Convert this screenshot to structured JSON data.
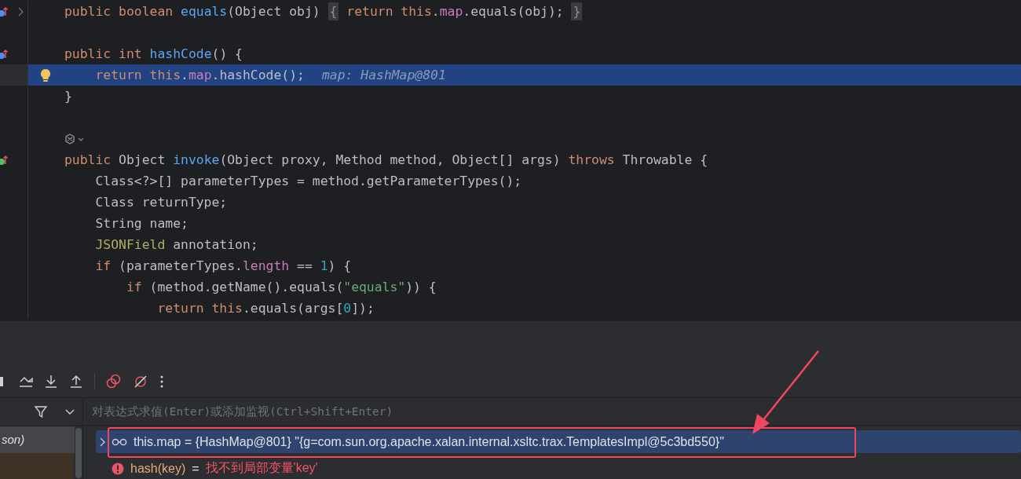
{
  "editor": {
    "lines": [
      {
        "marker": {
          "color": "#548af7"
        },
        "fold": true,
        "bulb": false,
        "highlighted": false,
        "tokens": [
          {
            "text": "public boolean ",
            "kind": "keyword"
          },
          {
            "text": "equals",
            "kind": "function"
          },
          {
            "text": "(Object obj) ",
            "kind": "plain"
          },
          {
            "text": "{",
            "kind": "fold"
          },
          {
            "text": " return this",
            "kind": "keyword"
          },
          {
            "text": ".",
            "kind": "plain"
          },
          {
            "text": "map",
            "kind": "field"
          },
          {
            "text": ".equals(obj); ",
            "kind": "plain"
          },
          {
            "text": "}",
            "kind": "fold"
          }
        ]
      },
      {
        "fold": false,
        "bulb": false,
        "highlighted": false
      },
      {
        "marker": {
          "color": "#548af7"
        },
        "fold": false,
        "bulb": false,
        "highlighted": false,
        "tokens": [
          {
            "text": "public int ",
            "kind": "keyword"
          },
          {
            "text": "hashCode",
            "kind": "function"
          },
          {
            "text": "() {",
            "kind": "plain"
          }
        ]
      },
      {
        "fold": false,
        "bulb": true,
        "highlighted": true,
        "tokens": [
          {
            "text": "    return this",
            "kind": "keyword"
          },
          {
            "text": ".",
            "kind": "plain"
          },
          {
            "text": "map",
            "kind": "field"
          },
          {
            "text": ".hashCode();",
            "kind": "plain"
          }
        ],
        "inline_value": "map: HashMap@801"
      },
      {
        "fold": false,
        "bulb": false,
        "highlighted": false,
        "tokens": [
          {
            "text": "}",
            "kind": "plain"
          }
        ]
      },
      {
        "fold": false,
        "bulb": false,
        "highlighted": false
      },
      {
        "fold": false,
        "bulb": false,
        "highlighted": false,
        "inlay": true
      },
      {
        "marker": {
          "color": "#5fb865"
        },
        "fold": false,
        "bulb": false,
        "highlighted": false,
        "tokens": [
          {
            "text": "public ",
            "kind": "keyword"
          },
          {
            "text": "Object ",
            "kind": "plain"
          },
          {
            "text": "invoke",
            "kind": "function"
          },
          {
            "text": "(Object proxy, Method method, Object[] args) ",
            "kind": "plain"
          },
          {
            "text": "throws",
            "kind": "keyword"
          },
          {
            "text": " Throwable {",
            "kind": "plain"
          }
        ]
      },
      {
        "fold": false,
        "bulb": false,
        "highlighted": false,
        "tokens": [
          {
            "text": "    Class<?>[] parameterTypes = method.getParameterTypes();",
            "kind": "plain"
          }
        ]
      },
      {
        "fold": false,
        "bulb": false,
        "highlighted": false,
        "tokens": [
          {
            "text": "    Class returnType;",
            "kind": "plain"
          }
        ]
      },
      {
        "fold": false,
        "bulb": false,
        "highlighted": false,
        "tokens": [
          {
            "text": "    String name;",
            "kind": "plain"
          }
        ]
      },
      {
        "fold": false,
        "bulb": false,
        "highlighted": false,
        "tokens": [
          {
            "text": "    JSONField",
            "kind": "type"
          },
          {
            "text": " annotation;",
            "kind": "plain"
          }
        ]
      },
      {
        "fold": false,
        "bulb": false,
        "highlighted": false,
        "tokens": [
          {
            "text": "    if",
            "kind": "keyword"
          },
          {
            "text": " (parameterTypes.",
            "kind": "plain"
          },
          {
            "text": "length",
            "kind": "field"
          },
          {
            "text": " == ",
            "kind": "plain"
          },
          {
            "text": "1",
            "kind": "number"
          },
          {
            "text": ") {",
            "kind": "plain"
          }
        ]
      },
      {
        "fold": false,
        "bulb": false,
        "highlighted": false,
        "tokens": [
          {
            "text": "        if",
            "kind": "keyword"
          },
          {
            "text": " (method.getName().equals(",
            "kind": "plain"
          },
          {
            "text": "\"equals\"",
            "kind": "string"
          },
          {
            "text": ")) {",
            "kind": "plain"
          }
        ]
      },
      {
        "fold": false,
        "bulb": false,
        "highlighted": false,
        "tokens": [
          {
            "text": "            return this",
            "kind": "keyword"
          },
          {
            "text": ".equals(args[",
            "kind": "plain"
          },
          {
            "text": "0",
            "kind": "number"
          },
          {
            "text": "]);",
            "kind": "plain"
          }
        ]
      }
    ]
  },
  "debugger": {
    "frame": {
      "label": "son)",
      "selected": true
    },
    "watch_placeholder": "对表达式求值(Enter)或添加监视(Ctrl+Shift+Enter)",
    "watches": [
      {
        "kind": "value",
        "selected": true,
        "text": "this.map = {HashMap@801} \"{g=com.sun.org.apache.xalan.internal.xsltc.trax.TemplatesImpl@5c3bd550}\""
      },
      {
        "kind": "error",
        "selected": false,
        "name": "hash(key)",
        "separator": "=",
        "message": "找不到局部变量'key'"
      }
    ]
  }
}
